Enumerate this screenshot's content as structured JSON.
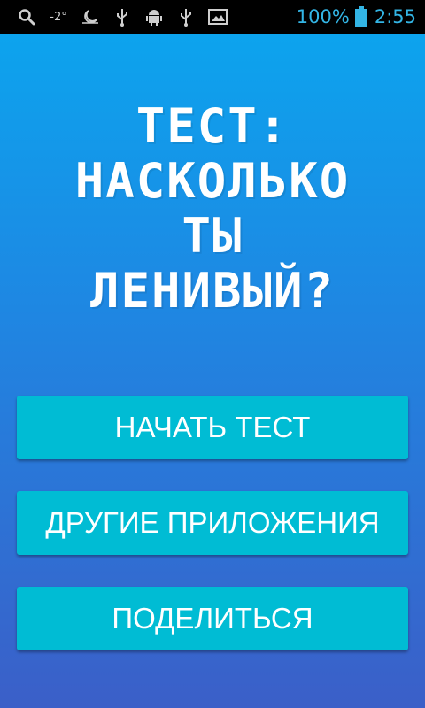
{
  "status_bar": {
    "icons": [
      "search-icon",
      "weather-icon",
      "night-mode-icon",
      "usb-icon",
      "android-debug-icon",
      "usb-icon",
      "image-icon"
    ],
    "temperature": "-2°",
    "battery_percent": "100%",
    "time": "2:55",
    "colors": {
      "background": "#000000",
      "icon": "#cfcfcf",
      "accent": "#33b5e5"
    }
  },
  "title": {
    "lines": [
      "ТЕСТ:",
      "НАСКОЛЬКО",
      "ТЫ",
      "ЛЕНИВЫЙ?"
    ]
  },
  "buttons": {
    "start": "НАЧАТЬ ТЕСТ",
    "other_apps": "ДРУГИЕ ПРИЛОЖЕНИЯ",
    "share": "ПОДЕЛИТЬСЯ"
  },
  "colors": {
    "background_top": "#0aa7ef",
    "background_bottom": "#3b5fc8",
    "button": "#00bcd4",
    "text": "#ffffff"
  }
}
